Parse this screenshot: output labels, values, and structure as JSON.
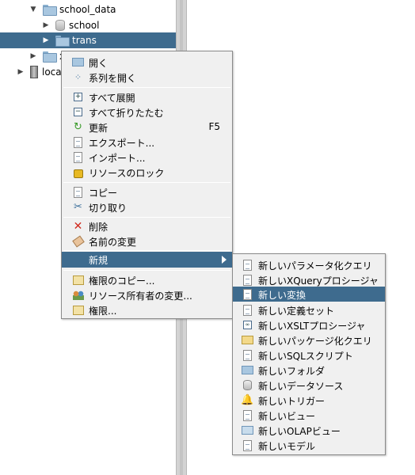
{
  "tree": {
    "items": [
      {
        "label": "school_data",
        "toggle": "▼",
        "icon": "folder-icon"
      },
      {
        "label": "school",
        "toggle": "▶",
        "icon": "database-icon"
      },
      {
        "label": "trans",
        "toggle": "▶",
        "icon": "folder-icon",
        "selected": true
      },
      {
        "label": "xl",
        "toggle": "▶",
        "icon": "folder-icon"
      },
      {
        "label": "loca",
        "toggle": "▶",
        "icon": "server-icon"
      }
    ]
  },
  "context_menu": {
    "items": [
      {
        "label": "開く",
        "icon": "open-folder-icon"
      },
      {
        "label": "系列を開く",
        "icon": "lineage-icon"
      },
      {
        "label": "すべて展開",
        "icon": "expand-icon"
      },
      {
        "label": "すべて折りたたむ",
        "icon": "collapse-icon"
      },
      {
        "label": "更新",
        "icon": "refresh-icon",
        "shortcut": "F5"
      },
      {
        "label": "エクスポート...",
        "icon": "export-icon"
      },
      {
        "label": "インポート...",
        "icon": "import-icon"
      },
      {
        "label": "リソースのロック",
        "icon": "lock-icon"
      },
      {
        "label": "コピー",
        "icon": "copy-icon"
      },
      {
        "label": "切り取り",
        "icon": "cut-icon"
      },
      {
        "label": "削除",
        "icon": "delete-icon"
      },
      {
        "label": "名前の変更",
        "icon": "rename-icon"
      },
      {
        "label": "新規",
        "icon": "",
        "submenu": true
      },
      {
        "label": "権限のコピー...",
        "icon": "copy-permissions-icon"
      },
      {
        "label": "リソース所有者の変更...",
        "icon": "owner-icon"
      },
      {
        "label": "権限...",
        "icon": "permissions-icon"
      }
    ]
  },
  "submenu": {
    "items": [
      {
        "label": "新しいパラメータ化クエリ",
        "icon": "parameterized-query-icon"
      },
      {
        "label": "新しいXQueryプロシージャ",
        "icon": "xquery-icon"
      },
      {
        "label": "新しい変換",
        "icon": "transform-icon"
      },
      {
        "label": "新しい定義セット",
        "icon": "definition-set-icon"
      },
      {
        "label": "新しいXSLTプロシージャ",
        "icon": "xslt-icon"
      },
      {
        "label": "新しいパッケージ化クエリ",
        "icon": "packaged-query-icon"
      },
      {
        "label": "新しいSQLスクリプト",
        "icon": "sql-script-icon"
      },
      {
        "label": "新しいフォルダ",
        "icon": "folder-icon"
      },
      {
        "label": "新しいデータソース",
        "icon": "datasource-icon"
      },
      {
        "label": "新しいトリガー",
        "icon": "trigger-icon"
      },
      {
        "label": "新しいビュー",
        "icon": "view-icon"
      },
      {
        "label": "新しいOLAPビュー",
        "icon": "olap-view-icon"
      },
      {
        "label": "新しいモデル",
        "icon": "model-icon"
      }
    ]
  },
  "colors": {
    "highlight": "#3e6b8e",
    "menu_bg": "#f0f0f0"
  }
}
